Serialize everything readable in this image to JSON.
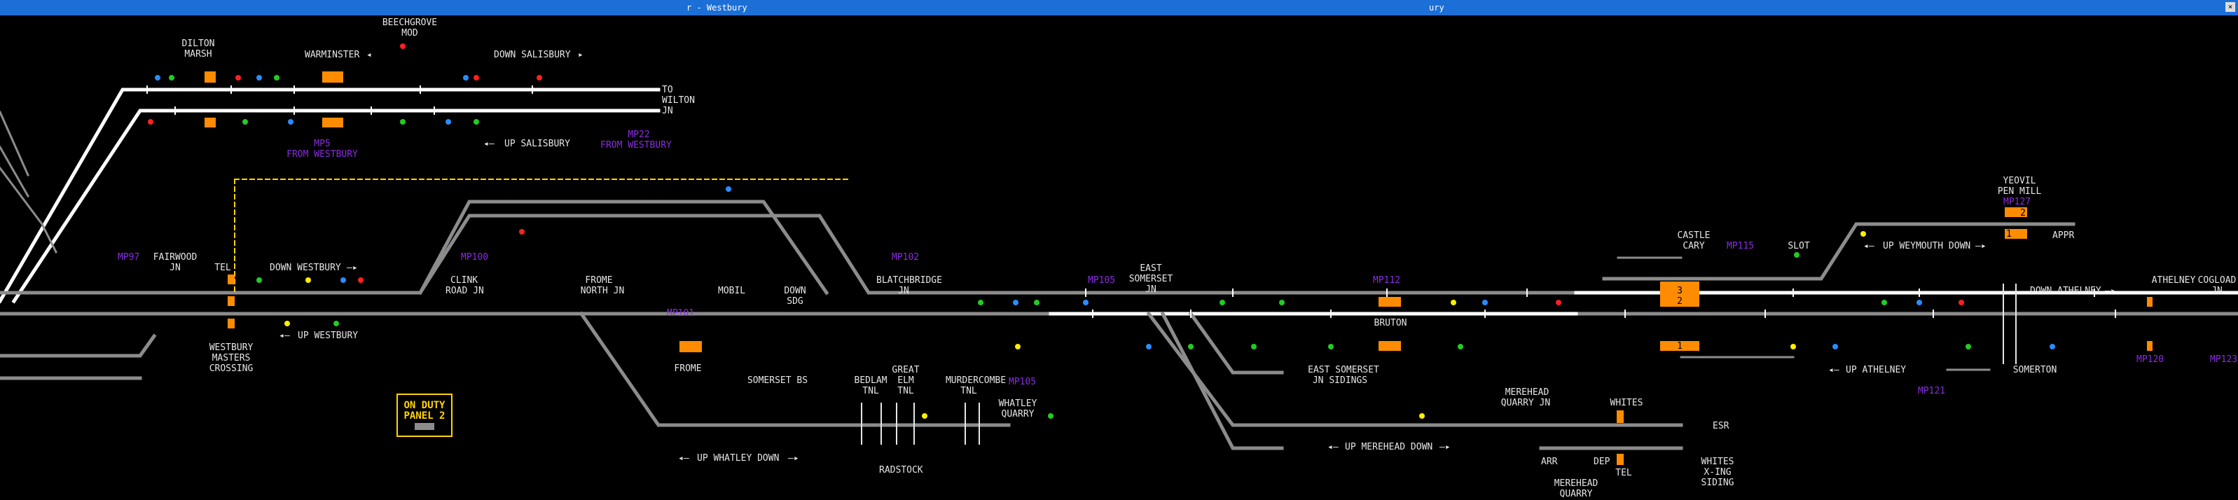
{
  "window": {
    "title_left": "r - Westbury",
    "title_right": "ury",
    "close_label": "×"
  },
  "colors": {
    "track": "#8c8c8c",
    "track_set": "#ffffff",
    "signal_red": "#ff2020",
    "signal_green": "#22cc22",
    "signal_yellow": "#ffee00",
    "signal_blue": "#2a8cff",
    "berth_orange": "#ff8c00",
    "milepost_purple": "#8a2be2",
    "onduty_yellow": "#ffd400"
  },
  "labels": {
    "dilton_marsh": [
      "DILTON",
      "MARSH"
    ],
    "beechgrove_mod": [
      "BEECHGROVE",
      "MOD"
    ],
    "warminster": "WARMINSTER",
    "down_salisbury": "DOWN SALISBURY",
    "to_wilton_jn": [
      "TO",
      "WILTON",
      "JN"
    ],
    "up_salisbury": "UP SALISBURY",
    "fairwood_jn": [
      "FAIRWOOD",
      "JN"
    ],
    "tel": "TEL",
    "down_westbury": "DOWN WESTBURY",
    "up_westbury": "UP WESTBURY",
    "westbury_masters_crossing": [
      "WESTBURY",
      "MASTERS",
      "CROSSING"
    ],
    "clink_road_jn": [
      "CLINK",
      "ROAD JN"
    ],
    "frome_north_jn": [
      "FROME",
      "NORTH JN"
    ],
    "mobil": "MOBIL",
    "down_sdg": [
      "DOWN",
      "SDG"
    ],
    "frome": "FROME",
    "somerset_bs": "SOMERSET BS",
    "blatchbridge_jn": [
      "BLATCHBRIDGE",
      "JN"
    ],
    "bedlam_tnl": [
      "BEDLAM",
      "TNL"
    ],
    "great_elm_tnl": [
      "GREAT",
      "ELM",
      "TNL"
    ],
    "murdercombe_tnl": [
      "MURDERCOMBE",
      "TNL"
    ],
    "whatley_quarry": [
      "WHATLEY",
      "QUARRY"
    ],
    "up_whatley_down": "UP WHATLEY DOWN",
    "radstock": "RADSTOCK",
    "east_somerset_jn": [
      "EAST",
      "SOMERSET",
      "JN"
    ],
    "bruton": "BRUTON",
    "east_somerset_jn_sidings": [
      "EAST SOMERSET",
      "JN SIDINGS"
    ],
    "merehead_quarry_jn": [
      "MEREHEAD",
      "QUARRY JN"
    ],
    "up_merehead_down": "UP MEREHEAD DOWN",
    "whites": "WHITES",
    "esr": "ESR",
    "arr": "ARR",
    "dep": "DEP",
    "tel2": "TEL",
    "merehead_quarry": [
      "MEREHEAD",
      "QUARRY"
    ],
    "whites_xing_siding": [
      "WHITES",
      "X-ING",
      "SIDING"
    ],
    "castle_cary": [
      "CASTLE",
      "CARY"
    ],
    "slot": "SLOT",
    "yeovil_pen_mill": [
      "YEOVIL",
      "PEN MILL"
    ],
    "up_weymouth_down": "UP WEYMOUTH DOWN",
    "appr": "APPR",
    "down_athelney": "DOWN ATHELNEY",
    "athelney": "ATHELNEY",
    "up_athelney": "UP ATHELNEY",
    "somerton": "SOMERTON",
    "cogload_jn": [
      "COGLOAD",
      "JN"
    ],
    "on_duty": [
      "ON DUTY",
      "PANEL 2"
    ]
  },
  "mileposts": {
    "mp95_from_westbury": [
      "MP5",
      "FROM WESTBURY"
    ],
    "mp22_from_westbury": [
      "MP22",
      "FROM WESTBURY"
    ],
    "mp97": "MP97",
    "mp100": "MP100",
    "mp101": "MP101",
    "mp102": "MP102",
    "mp105a": "MP105",
    "mp105b": "MP105",
    "mp112": "MP112",
    "mp115": "MP115",
    "mp121": "MP121",
    "mp127": "MP127",
    "mp120": "MP120",
    "mp123": "MP123"
  },
  "berths": {
    "castle_cary_3": "3",
    "castle_cary_2": "2",
    "castle_cary_1": "1",
    "yeovil_2": "2",
    "yeovil_1": "1"
  }
}
